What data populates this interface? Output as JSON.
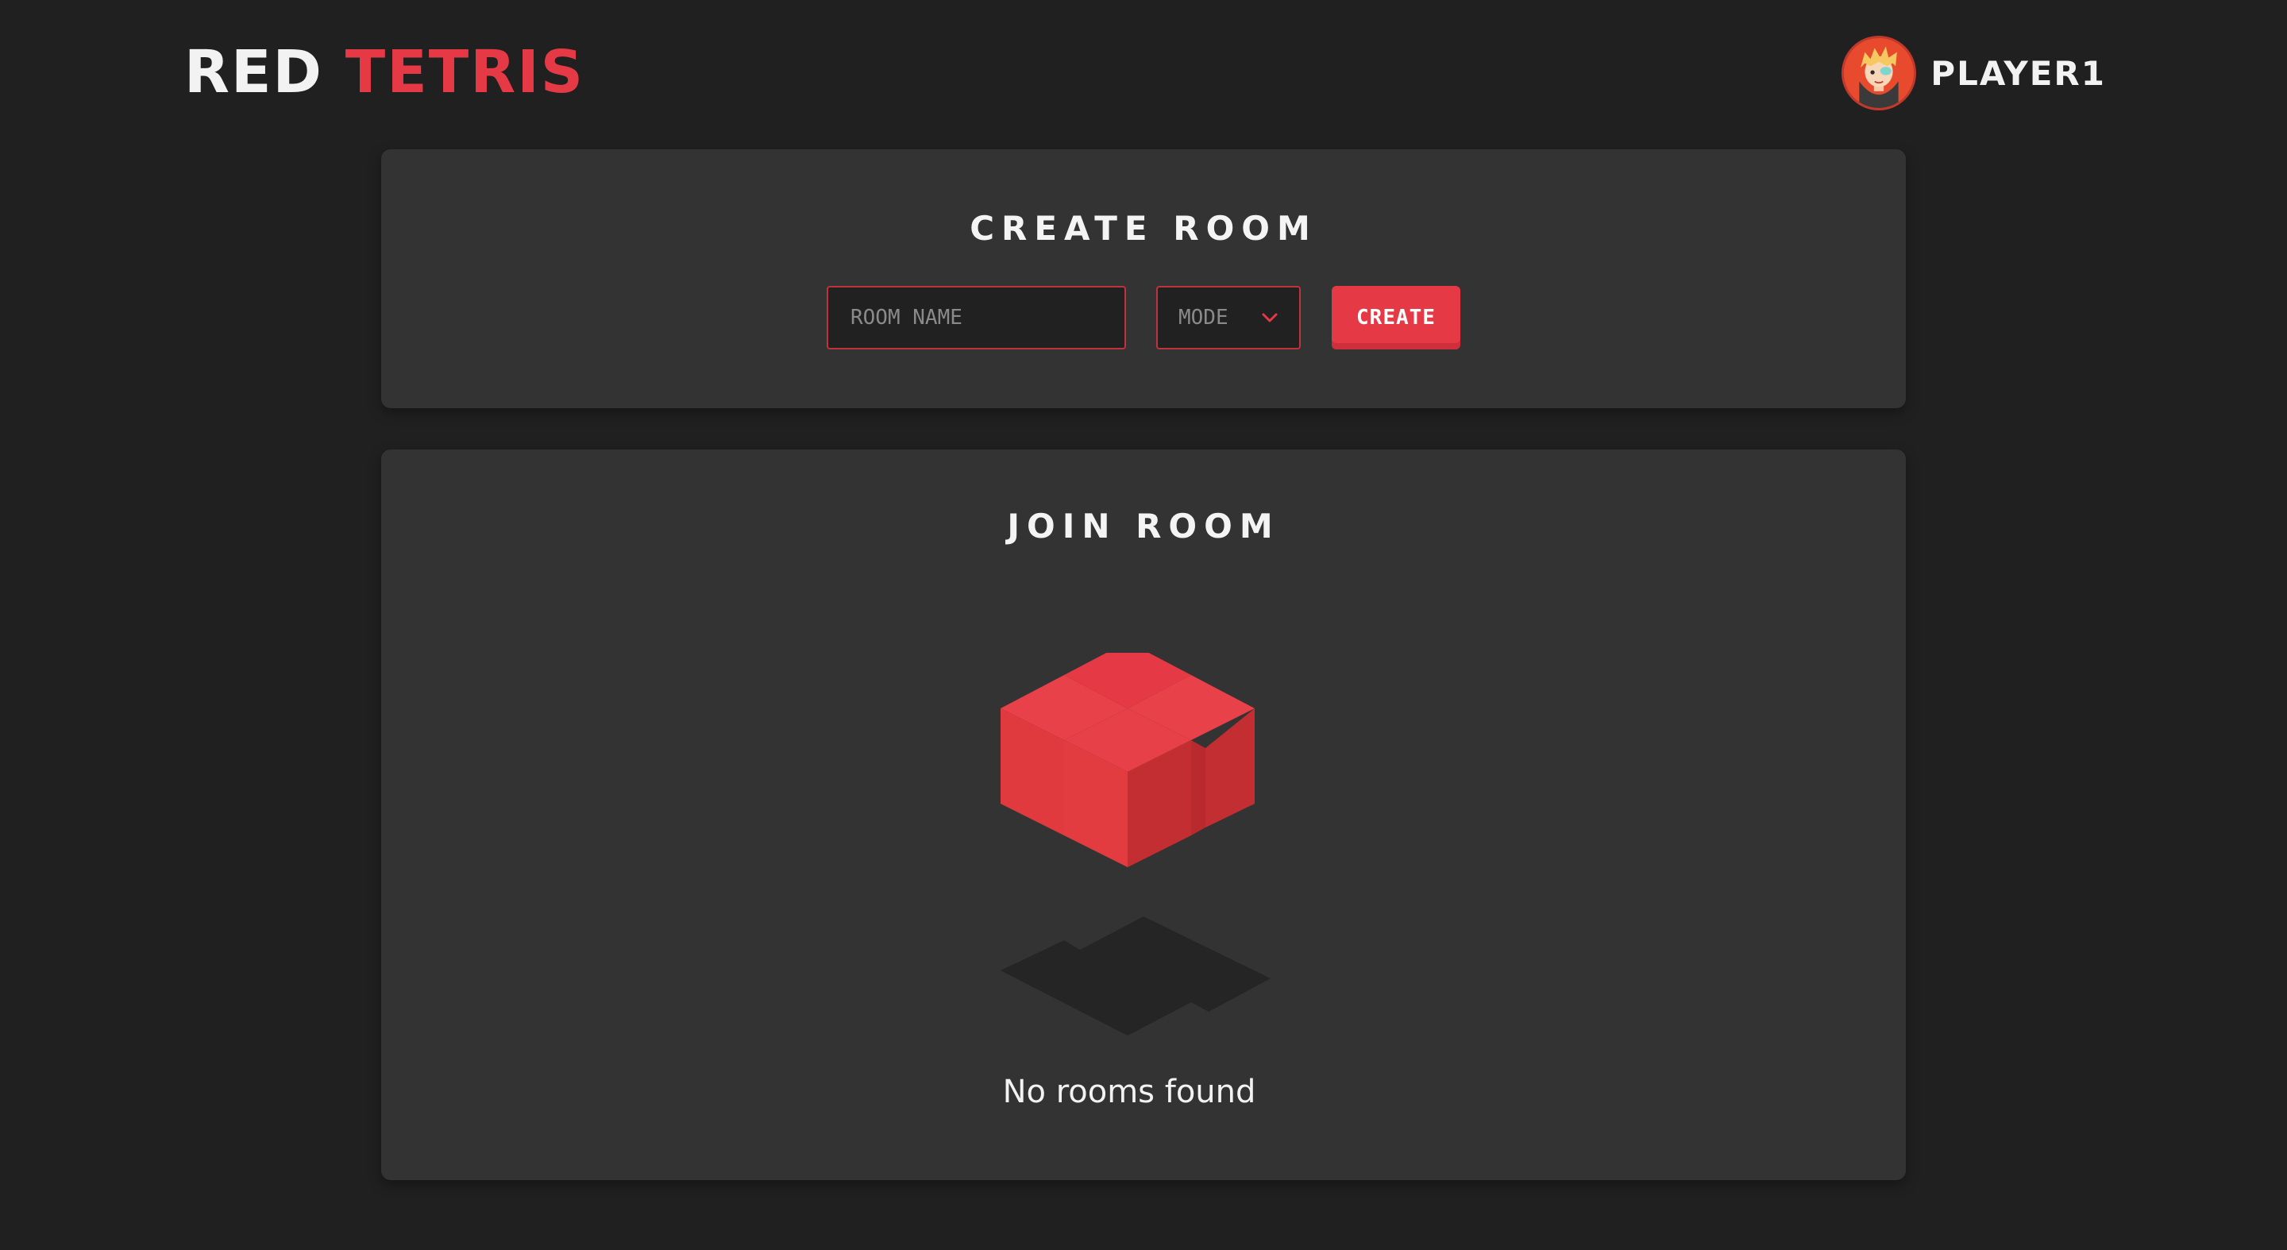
{
  "header": {
    "logo_word1": "RED",
    "logo_word2": "TETRIS",
    "username": "PLAYER1",
    "avatar_icon": "player-avatar-icon"
  },
  "create_room": {
    "title": "CREATE ROOM",
    "room_name_placeholder": "ROOM NAME",
    "room_name_value": "",
    "mode_label": "MODE",
    "mode_icon": "chevron-down-icon",
    "create_label": "CREATE"
  },
  "join_room": {
    "title": "JOIN ROOM",
    "empty_icon": "tetris-block-icon",
    "empty_message": "No rooms found"
  },
  "colors": {
    "background": "#202020",
    "card": "#333333",
    "accent": "#e63946",
    "input_bg": "#212121",
    "text": "#ffffff",
    "muted": "#8a8a8a"
  }
}
